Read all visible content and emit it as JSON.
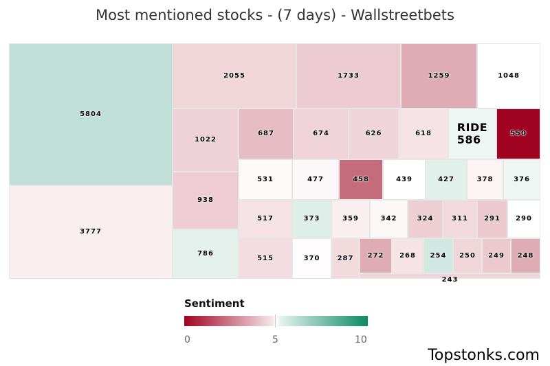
{
  "chart_data": {
    "type": "treemap",
    "title": "Most mentioned stocks - (7 days) - Wallstreetbets",
    "colorAxis": {
      "title": "Sentiment",
      "min": 0,
      "max": 10,
      "ticks": [
        "0",
        "5",
        "10"
      ],
      "minColor": "#a00321",
      "midColor": "#ffffff",
      "maxColor": "#0c8a63"
    },
    "cells": [
      {
        "value": 5804,
        "color": "#c0dfd6"
      },
      {
        "value": 3777,
        "color": "#f9eff0"
      },
      {
        "value": 2055,
        "color": "#f0d5d9"
      },
      {
        "value": 1733,
        "color": "#ecccd2"
      },
      {
        "value": 1259,
        "color": "#dfabb5"
      },
      {
        "value": 1048,
        "color": "#ffffff"
      },
      {
        "value": 1022,
        "color": "#eed1d6"
      },
      {
        "value": 938,
        "color": "#edcdd3"
      },
      {
        "value": 786,
        "color": "#e3f0ec"
      },
      {
        "value": 687,
        "color": "#e6bcc4"
      },
      {
        "value": 674,
        "color": "#efd3d8"
      },
      {
        "value": 626,
        "color": "#efd5d9"
      },
      {
        "value": 618,
        "color": "#f6e3e6"
      },
      {
        "value": 586,
        "label": "RIDE",
        "color": "#eef6f4"
      },
      {
        "value": 550,
        "color": "#a00321"
      },
      {
        "value": 531,
        "color": "#fdfaf9"
      },
      {
        "value": 477,
        "color": "#fcf7f8"
      },
      {
        "value": 458,
        "color": "#c56c7c"
      },
      {
        "value": 439,
        "color": "#ffffff"
      },
      {
        "value": 427,
        "color": "#e2f0eb"
      },
      {
        "value": 378,
        "color": "#fbf3f4"
      },
      {
        "value": 376,
        "color": "#eef6f3"
      },
      {
        "value": 517,
        "color": "#f6e1e4"
      },
      {
        "value": 373,
        "color": "#deeee9"
      },
      {
        "value": 359,
        "color": "#f9eef0"
      },
      {
        "value": 342,
        "color": "#fcf8f8"
      },
      {
        "value": 324,
        "color": "#edced3"
      },
      {
        "value": 311,
        "color": "#f1d9dd"
      },
      {
        "value": 291,
        "color": "#ebc9cf"
      },
      {
        "value": 290,
        "color": "#ffffff"
      },
      {
        "value": 515,
        "color": "#f4dde1"
      },
      {
        "value": 370,
        "color": "#fefcfc"
      },
      {
        "value": 287,
        "color": "#f2dadd"
      },
      {
        "value": 272,
        "color": "#dfabb5"
      },
      {
        "value": 268,
        "color": "#f6e3e6"
      },
      {
        "value": 254,
        "color": "#d0e8e1"
      },
      {
        "value": 250,
        "color": "#f0d5d9"
      },
      {
        "value": 249,
        "color": "#ebc9cf"
      },
      {
        "value": 248,
        "color": "#dfabb5"
      },
      {
        "value": 243,
        "color": "#f0d5d9"
      }
    ]
  },
  "brand": "Topstonks.com"
}
